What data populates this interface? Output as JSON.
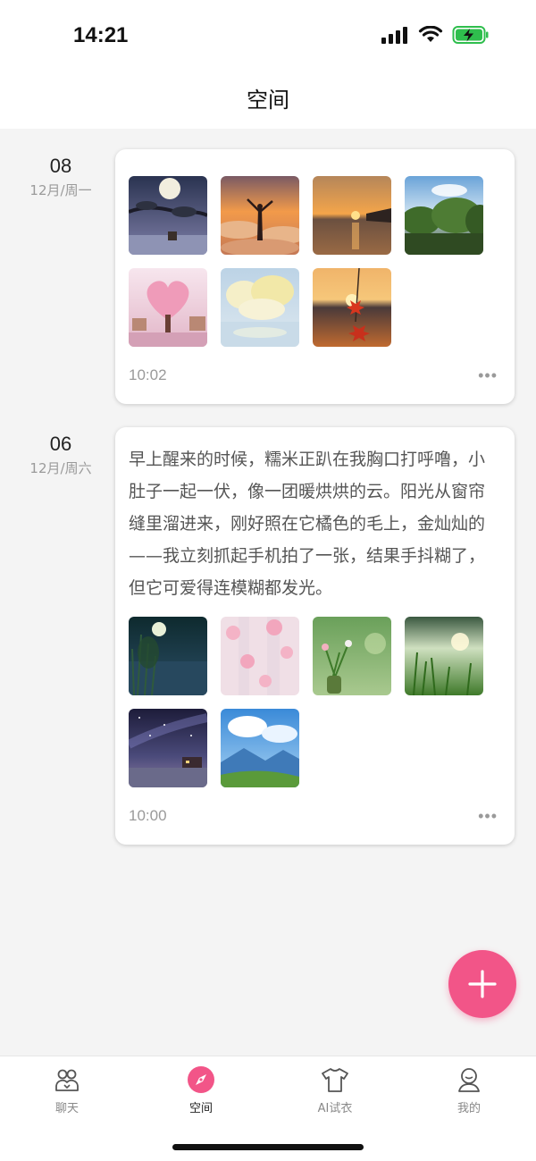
{
  "status_bar": {
    "time": "14:21"
  },
  "header": {
    "title": "空间"
  },
  "posts": [
    {
      "day": "08",
      "date_sub": "12月/周一",
      "text": "",
      "time": "10:02",
      "more": "•••",
      "images": [
        "moon-tree-image",
        "sunrise-clouds-image",
        "sunset-lake-image",
        "green-trees-image",
        "pink-heart-tree-image",
        "white-flower-tree-image",
        "maple-sunset-image"
      ]
    },
    {
      "day": "06",
      "date_sub": "12月/周六",
      "text": "早上醒来的时候，糯米正趴在我胸口打呼噜，小肚子一起一伏，像一团暖烘烘的云。阳光从窗帘缝里溜进来，刚好照在它橘色的毛上，金灿灿的——我立刻抓起手机拍了一张，结果手抖糊了，但它可爱得连模糊都发光。",
      "time": "10:00",
      "more": "•••",
      "images": [
        "moon-reeds-image",
        "cherry-blossom-image",
        "green-vase-image",
        "reed-sunlight-image",
        "starry-beach-image",
        "blue-mountain-image"
      ]
    }
  ],
  "fab": {
    "icon": "plus-icon",
    "color": "#f25588"
  },
  "tabbar": {
    "items": [
      {
        "label": "聊天",
        "icon": "chat-users-icon"
      },
      {
        "label": "空间",
        "icon": "compass-icon"
      },
      {
        "label": "AI试衣",
        "icon": "tshirt-icon"
      },
      {
        "label": "我的",
        "icon": "profile-icon"
      }
    ]
  },
  "colors": {
    "accent": "#f25588",
    "background": "#f4f4f4"
  }
}
